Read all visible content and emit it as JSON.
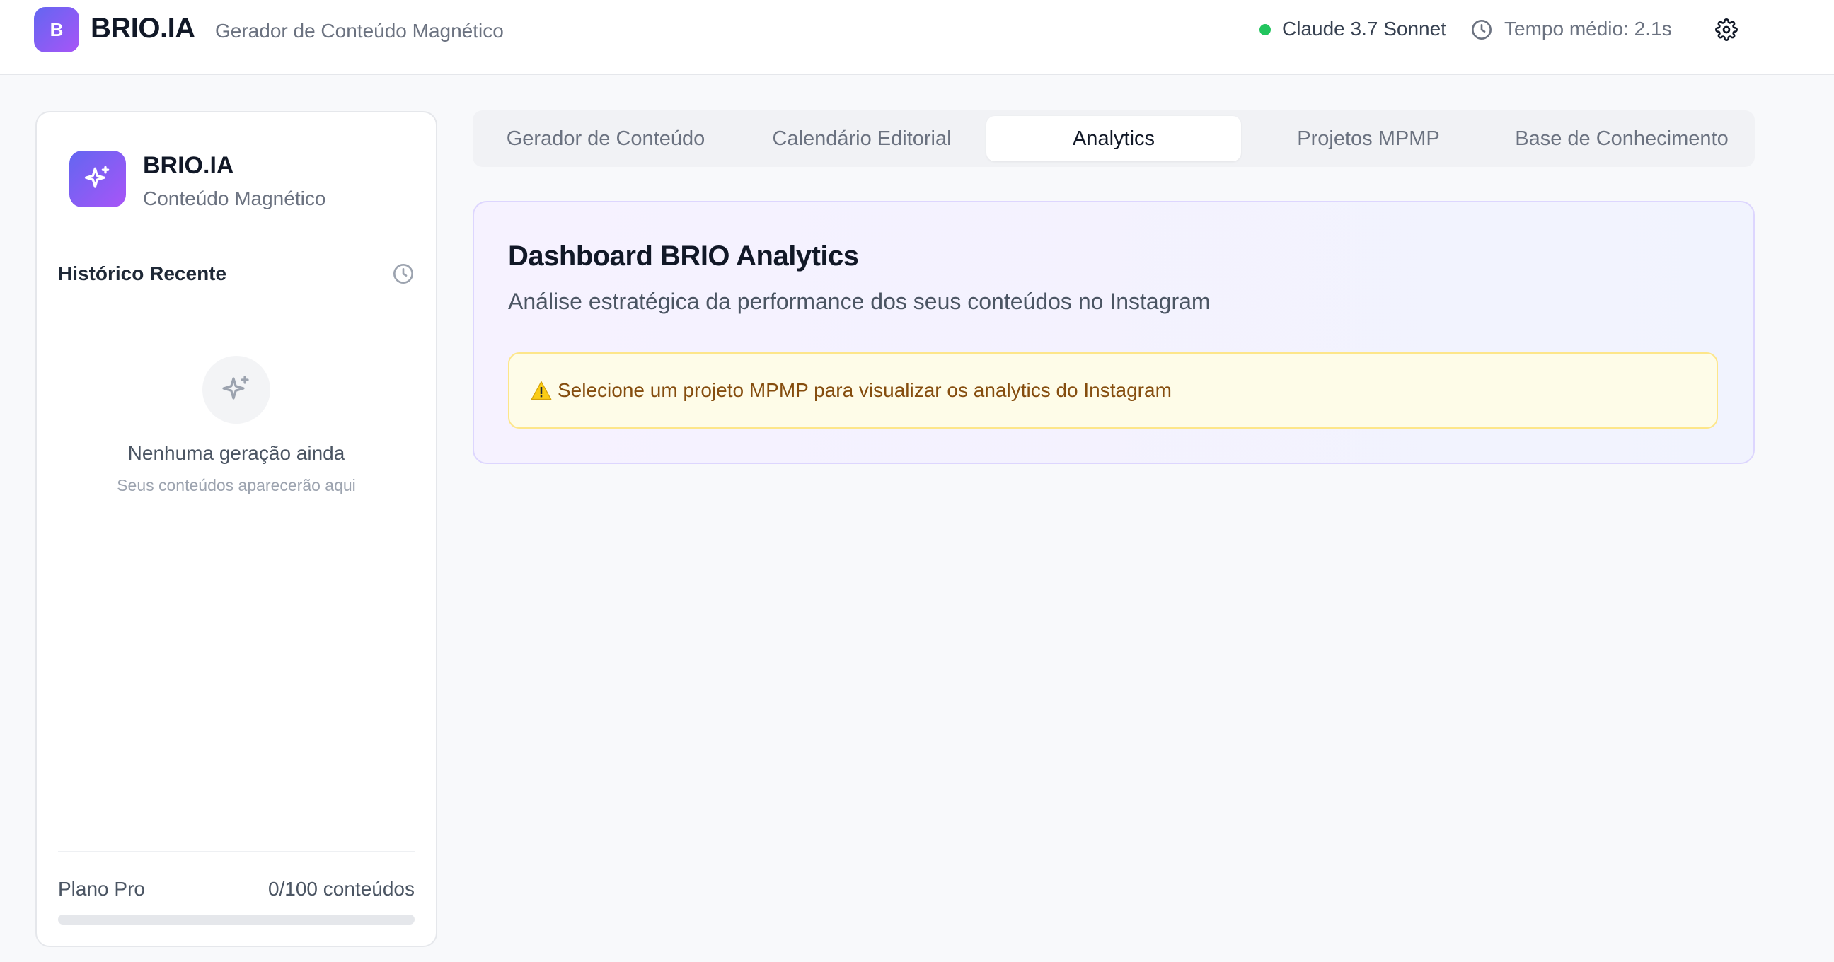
{
  "header": {
    "logo_letter": "B",
    "brand": "BRIO.IA",
    "tagline": "Gerador de Conteúdo Magnético",
    "model": "Claude 3.7 Sonnet",
    "avg_time": "Tempo médio: 2.1s",
    "status_color": "#22c55e"
  },
  "sidebar": {
    "brand": "BRIO.IA",
    "subtitle": "Conteúdo Magnético",
    "history_title": "Histórico Recente",
    "empty_title": "Nenhuma geração ainda",
    "empty_subtitle": "Seus conteúdos aparecerão aqui",
    "plan_label": "Plano Pro",
    "plan_usage": "0/100 conteúdos",
    "plan_progress": 0
  },
  "tabs": [
    {
      "label": "Gerador de Conteúdo",
      "active": false
    },
    {
      "label": "Calendário Editorial",
      "active": false
    },
    {
      "label": "Analytics",
      "active": true
    },
    {
      "label": "Projetos MPMP",
      "active": false
    },
    {
      "label": "Base de Conhecimento",
      "active": false
    }
  ],
  "dashboard": {
    "title": "Dashboard BRIO Analytics",
    "subtitle": "Análise estratégica da performance dos seus conteúdos no Instagram",
    "alert": "Selecione um projeto MPMP para visualizar os analytics do Instagram"
  },
  "colors": {
    "accent_from": "#6366f1",
    "accent_to": "#a855f7",
    "alert_bg": "#fefce8",
    "alert_text": "#854d0e"
  },
  "icons": [
    "settings-gear-icon",
    "clock-icon",
    "sparkles-icon",
    "warning-icon"
  ]
}
